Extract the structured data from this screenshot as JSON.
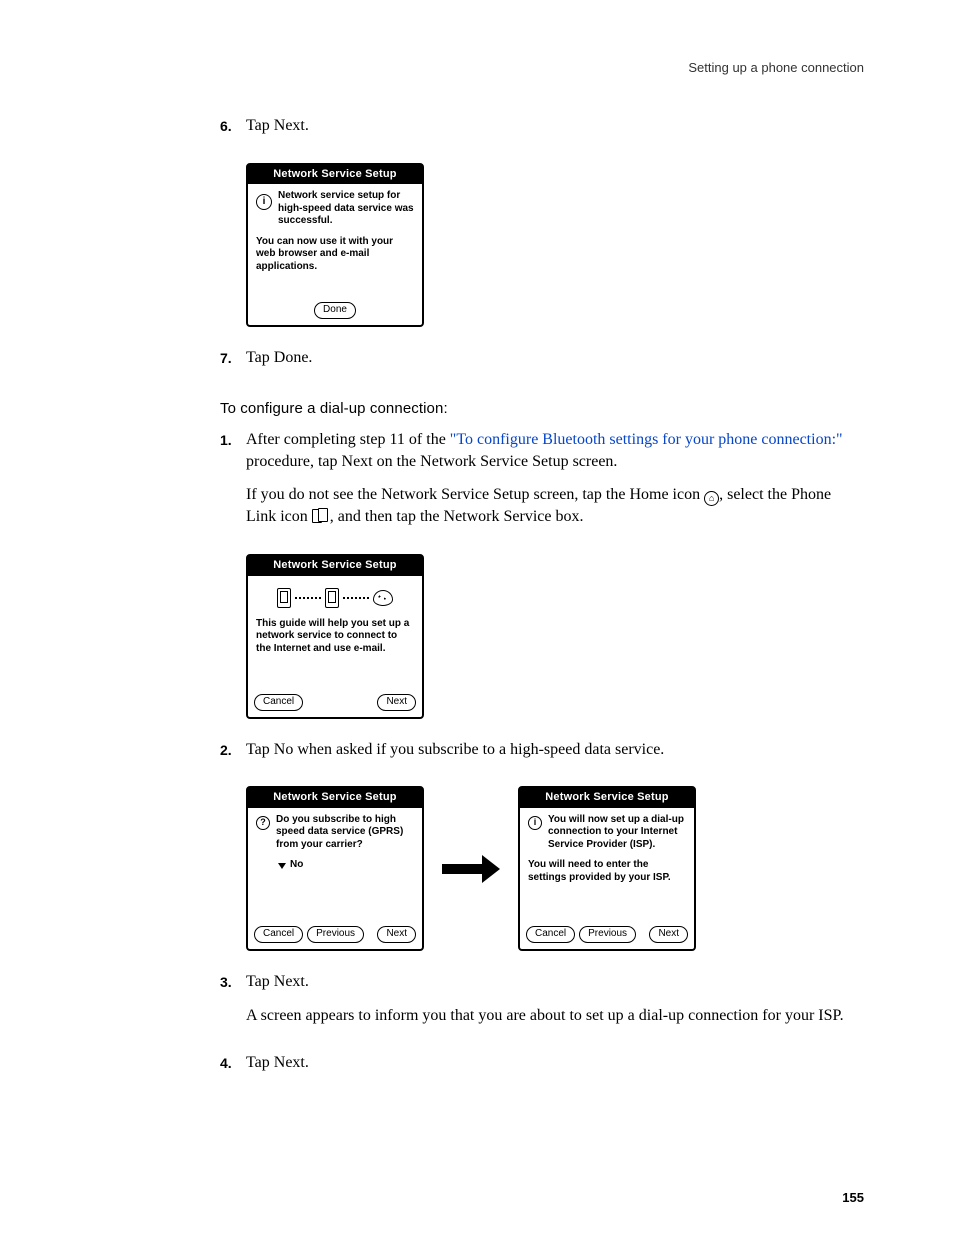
{
  "header": "Setting up a phone connection",
  "page_number": "155",
  "steps": {
    "s6": {
      "num": "6.",
      "text": "Tap Next."
    },
    "s7": {
      "num": "7.",
      "text": "Tap Done."
    },
    "heading": "To configure a dial-up connection:",
    "s1": {
      "num": "1.",
      "pre": "After completing step 11 of the ",
      "link": "\"To configure Bluetooth settings for your phone connection:\"",
      "post": " procedure, tap Next on the Network Service Setup screen.",
      "para2a": "If you do not see the Network Service Setup screen, tap the Home icon ",
      "para2b": ", select the Phone Link icon ",
      "para2c": ", and then tap the Network Service box."
    },
    "s2": {
      "num": "2.",
      "text": "Tap No when asked if you subscribe to a high-speed data service."
    },
    "s3": {
      "num": "3.",
      "text": "Tap Next.",
      "para": "A screen appears to inform you that you are about to set up a dial-up connection for your ISP."
    },
    "s4": {
      "num": "4.",
      "text": "Tap Next."
    }
  },
  "palm": {
    "title": "Network Service Setup",
    "d1": {
      "info": "Network service setup for high-speed data service was successful.",
      "body": "You can now use it with your web browser and e-mail applications.",
      "done": "Done"
    },
    "d2": {
      "body": "This guide will help you set up a network service to connect to the Internet and use e-mail.",
      "cancel": "Cancel",
      "next": "Next"
    },
    "d3": {
      "q": "Do you subscribe to high speed data service (GPRS) from your carrier?",
      "no": "No",
      "cancel": "Cancel",
      "prev": "Previous",
      "next": "Next"
    },
    "d4": {
      "info": "You will now set up a dial-up connection to your Internet Service Provider (ISP).",
      "body": "You will need to enter the settings provided by your ISP.",
      "cancel": "Cancel",
      "prev": "Previous",
      "next": "Next"
    }
  },
  "icons": {
    "info_glyph": "i",
    "question_glyph": "?",
    "home_glyph": "⌂"
  }
}
